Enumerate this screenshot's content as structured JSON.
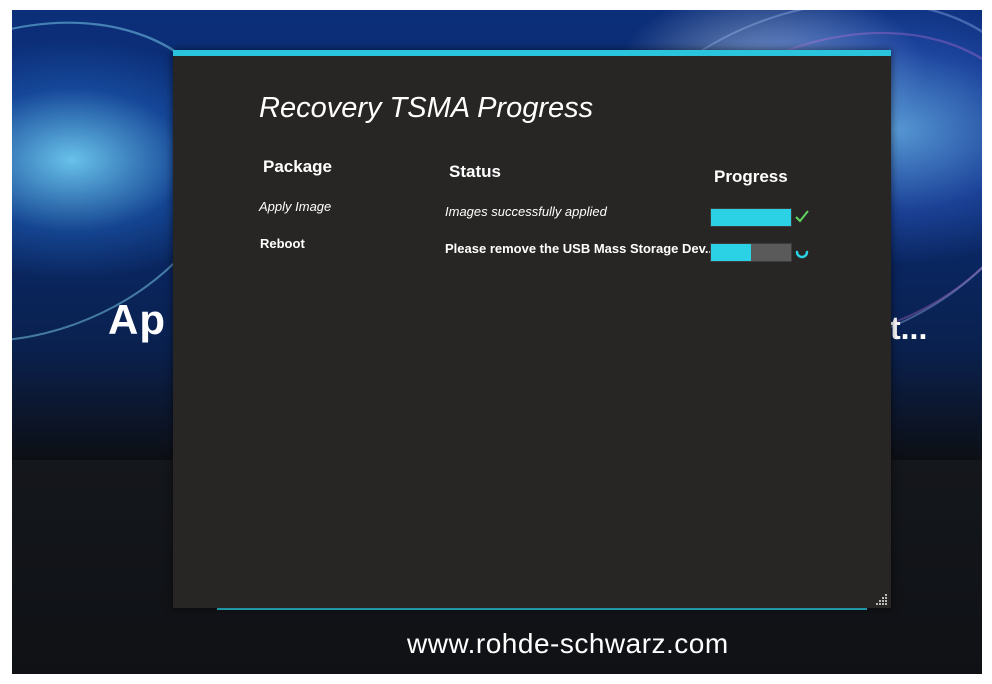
{
  "background": {
    "splash_left_fragment": "Ap",
    "splash_right_fragment": "t...",
    "website": "www.rohde-schwarz.com"
  },
  "dialog": {
    "title": "Recovery TSMA Progress",
    "columns": {
      "package": "Package",
      "status": "Status",
      "progress": "Progress"
    },
    "rows": [
      {
        "package": "Apply Image",
        "status": "Images successfully applied",
        "progress": 1.0,
        "state_icon": "check-icon"
      },
      {
        "package": "Reboot",
        "status": "Please remove the USB Mass Storage Dev...",
        "progress": 0.5,
        "state_icon": "spinner-icon"
      }
    ],
    "accent_color": "#2bc4dd",
    "progress_color": "#2bd2e6",
    "check_color": "#5fd45f"
  }
}
